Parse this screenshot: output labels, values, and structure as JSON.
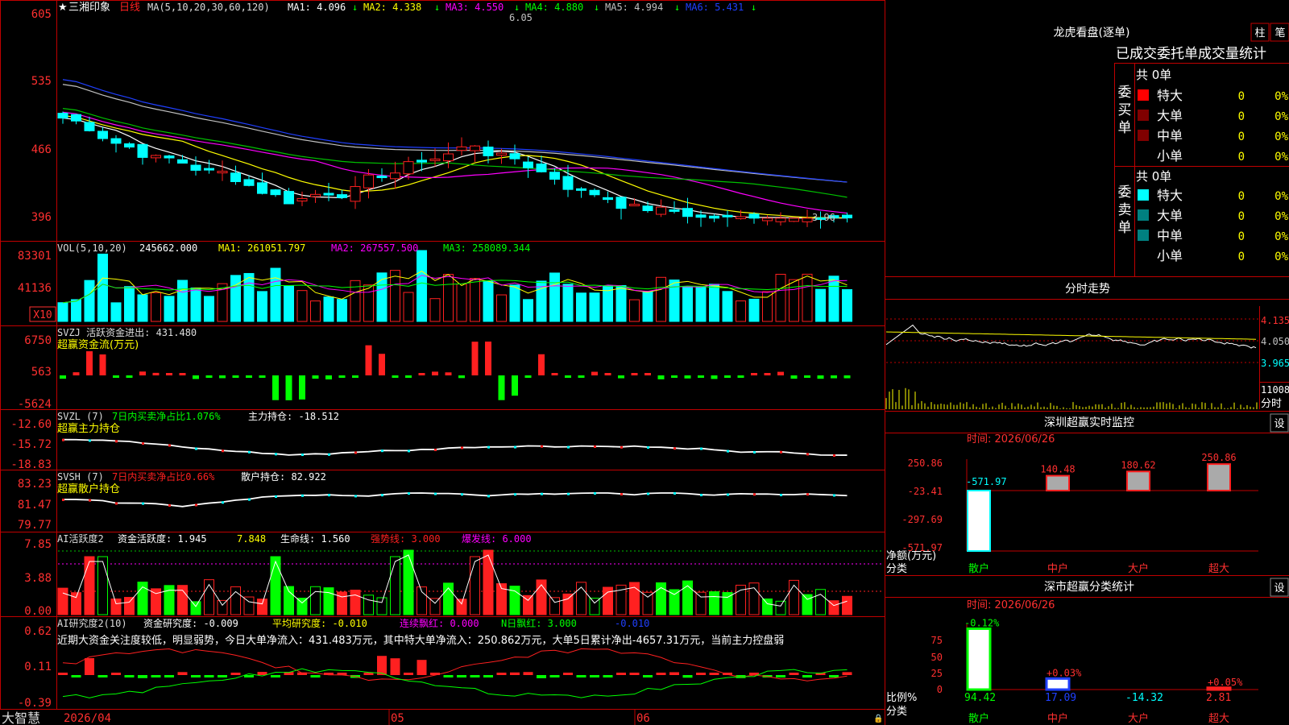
{
  "app": {
    "stock_name": "三湘印象",
    "period": "日线",
    "brand": "大智慧"
  },
  "price_panel": {
    "ma_header": "MA(5,10,20,30,60,120)",
    "ma1": "MA1: 4.096",
    "ma2": "MA2: 4.338",
    "ma3": "MA3: 4.550",
    "ma4": "MA4: 4.880",
    "ma5": "MA5: 4.994",
    "ma6": "MA6: 5.431",
    "y_ticks": [
      "605",
      "535",
      "466",
      "396"
    ],
    "high_label": "6.05",
    "low_label": "3.96"
  },
  "vol_panel": {
    "header": "VOL(5,10,20)",
    "value": "245662.000",
    "ma1": "MA1: 261051.797",
    "ma2": "MA2: 267557.500",
    "ma3": "MA3: 258089.344",
    "y_ticks": [
      "83301",
      "41136"
    ],
    "unit": "X10"
  },
  "svzj_panel": {
    "header": "SVZJ  活跃资金进出: 431.480",
    "subtitle": "超赢资金流(万元)",
    "y_ticks": [
      "6750",
      "563",
      "-5624"
    ]
  },
  "svzl_panel": {
    "header": "SVZL (7)",
    "ratio": "7日内买卖净占比1.076%",
    "main": "主力持仓: -18.512",
    "subtitle": "超赢主力持仓",
    "y_ticks": [
      "-12.60",
      "-15.72",
      "-18.83"
    ]
  },
  "svsh_panel": {
    "header": "SVSH (7)",
    "ratio": "7日内买卖净占比0.66%",
    "retail": "散户持仓: 82.922",
    "subtitle": "超赢散户持仓",
    "y_ticks": [
      "83.23",
      "81.47",
      "79.77"
    ]
  },
  "ai_active_panel": {
    "header": "AI活跃度2",
    "activity": "资金活跃度: 1.945",
    "v2": "7.848",
    "life": "生命线: 1.560",
    "strong": "强势线: 3.000",
    "burst": "爆发线: 6.000",
    "y_ticks": [
      "7.85",
      "3.88",
      "0.00"
    ]
  },
  "ai_research_panel": {
    "header": "AI研究度2(10)",
    "research": "资金研究度: -0.009",
    "avg": "平均研究度: -0.010",
    "cont": "连续飘红: 0.000",
    "nday": "N日飘红: 3.000",
    "last": "-0.010",
    "commentary": "近期大资金关注度较低，明显弱势，今日大单净流入：431.483万元，其中特大单净流入：250.862万元，大单5日累计净出-4657.31万元，当前主力控盘弱",
    "y_ticks": [
      "0.62",
      "0.11",
      "-0.39"
    ]
  },
  "date_axis": {
    "labels": [
      "2026/04",
      "05",
      "06"
    ]
  },
  "dragon_tiger": {
    "title": "龙虎看盘(逐单)",
    "btn_bar": "柱",
    "btn_pen": "笔",
    "header": "已成交委托单成交量统计",
    "buy_label": "委买单",
    "sell_label": "委卖单",
    "buy_total": "共 0单",
    "sell_total": "共 0单",
    "rows": [
      "特大",
      "大单",
      "中单",
      "小单"
    ],
    "values": [
      "0",
      "0",
      "0",
      "0"
    ],
    "pcts": [
      "0%",
      "0%",
      "0%",
      "0%"
    ]
  },
  "intraday": {
    "title": "分时走势",
    "y_ticks": [
      "4.135",
      "4.050",
      "3.965"
    ],
    "vol_tick": "11008",
    "footer": "分时"
  },
  "sz_monitor": {
    "title": "深圳超赢实时监控",
    "settings": "设",
    "time": "时间: 2026/06/26",
    "y_ticks": [
      "250.86",
      "-23.41",
      "-297.69",
      "-571.97"
    ],
    "ylabel": "净额(万元)",
    "xlabel": "分类",
    "categories": [
      "散户",
      "中户",
      "大户",
      "超大"
    ],
    "bar_labels": [
      "-571.97",
      "140.48",
      "180.62",
      "250.86"
    ]
  },
  "sz_classify": {
    "title": "深市超赢分类统计",
    "settings": "设",
    "time": "时间: 2026/06/26",
    "y_ticks": [
      "75",
      "50",
      "25",
      "0"
    ],
    "ylabel": "比例%",
    "xlabel": "分类",
    "categories": [
      "散户",
      "中户",
      "大户",
      "超大"
    ],
    "top_labels": [
      "-0.12%",
      "+0.03%",
      "",
      "+0.05%"
    ],
    "bottom_labels": [
      "94.42",
      "17.09",
      "-14.32",
      "2.81"
    ]
  },
  "colors": {
    "up": "#ff2020",
    "down": "#00ffff",
    "panel_line": "#c00000",
    "yellow": "#ffff00",
    "magenta": "#ff00ff",
    "green": "#00ff00"
  }
}
